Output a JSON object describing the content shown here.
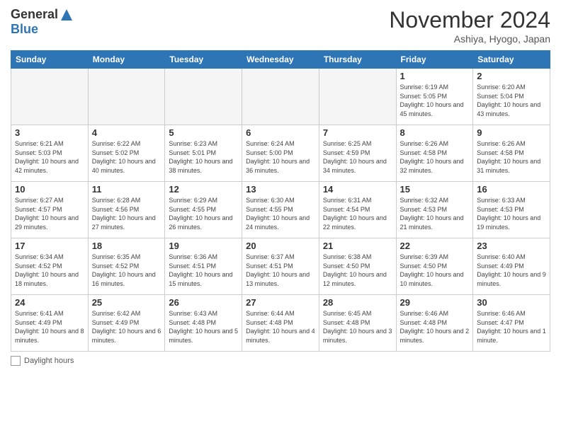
{
  "header": {
    "logo_general": "General",
    "logo_blue": "Blue",
    "month_title": "November 2024",
    "location": "Ashiya, Hyogo, Japan"
  },
  "days_of_week": [
    "Sunday",
    "Monday",
    "Tuesday",
    "Wednesday",
    "Thursday",
    "Friday",
    "Saturday"
  ],
  "legend": {
    "label": "Daylight hours"
  },
  "weeks": [
    [
      {
        "day": "",
        "empty": true
      },
      {
        "day": "",
        "empty": true
      },
      {
        "day": "",
        "empty": true
      },
      {
        "day": "",
        "empty": true
      },
      {
        "day": "",
        "empty": true
      },
      {
        "day": "1",
        "sunrise": "Sunrise: 6:19 AM",
        "sunset": "Sunset: 5:05 PM",
        "daylight": "Daylight: 10 hours and 45 minutes."
      },
      {
        "day": "2",
        "sunrise": "Sunrise: 6:20 AM",
        "sunset": "Sunset: 5:04 PM",
        "daylight": "Daylight: 10 hours and 43 minutes."
      }
    ],
    [
      {
        "day": "3",
        "sunrise": "Sunrise: 6:21 AM",
        "sunset": "Sunset: 5:03 PM",
        "daylight": "Daylight: 10 hours and 42 minutes."
      },
      {
        "day": "4",
        "sunrise": "Sunrise: 6:22 AM",
        "sunset": "Sunset: 5:02 PM",
        "daylight": "Daylight: 10 hours and 40 minutes."
      },
      {
        "day": "5",
        "sunrise": "Sunrise: 6:23 AM",
        "sunset": "Sunset: 5:01 PM",
        "daylight": "Daylight: 10 hours and 38 minutes."
      },
      {
        "day": "6",
        "sunrise": "Sunrise: 6:24 AM",
        "sunset": "Sunset: 5:00 PM",
        "daylight": "Daylight: 10 hours and 36 minutes."
      },
      {
        "day": "7",
        "sunrise": "Sunrise: 6:25 AM",
        "sunset": "Sunset: 4:59 PM",
        "daylight": "Daylight: 10 hours and 34 minutes."
      },
      {
        "day": "8",
        "sunrise": "Sunrise: 6:26 AM",
        "sunset": "Sunset: 4:58 PM",
        "daylight": "Daylight: 10 hours and 32 minutes."
      },
      {
        "day": "9",
        "sunrise": "Sunrise: 6:26 AM",
        "sunset": "Sunset: 4:58 PM",
        "daylight": "Daylight: 10 hours and 31 minutes."
      }
    ],
    [
      {
        "day": "10",
        "sunrise": "Sunrise: 6:27 AM",
        "sunset": "Sunset: 4:57 PM",
        "daylight": "Daylight: 10 hours and 29 minutes."
      },
      {
        "day": "11",
        "sunrise": "Sunrise: 6:28 AM",
        "sunset": "Sunset: 4:56 PM",
        "daylight": "Daylight: 10 hours and 27 minutes."
      },
      {
        "day": "12",
        "sunrise": "Sunrise: 6:29 AM",
        "sunset": "Sunset: 4:55 PM",
        "daylight": "Daylight: 10 hours and 26 minutes."
      },
      {
        "day": "13",
        "sunrise": "Sunrise: 6:30 AM",
        "sunset": "Sunset: 4:55 PM",
        "daylight": "Daylight: 10 hours and 24 minutes."
      },
      {
        "day": "14",
        "sunrise": "Sunrise: 6:31 AM",
        "sunset": "Sunset: 4:54 PM",
        "daylight": "Daylight: 10 hours and 22 minutes."
      },
      {
        "day": "15",
        "sunrise": "Sunrise: 6:32 AM",
        "sunset": "Sunset: 4:53 PM",
        "daylight": "Daylight: 10 hours and 21 minutes."
      },
      {
        "day": "16",
        "sunrise": "Sunrise: 6:33 AM",
        "sunset": "Sunset: 4:53 PM",
        "daylight": "Daylight: 10 hours and 19 minutes."
      }
    ],
    [
      {
        "day": "17",
        "sunrise": "Sunrise: 6:34 AM",
        "sunset": "Sunset: 4:52 PM",
        "daylight": "Daylight: 10 hours and 18 minutes."
      },
      {
        "day": "18",
        "sunrise": "Sunrise: 6:35 AM",
        "sunset": "Sunset: 4:52 PM",
        "daylight": "Daylight: 10 hours and 16 minutes."
      },
      {
        "day": "19",
        "sunrise": "Sunrise: 6:36 AM",
        "sunset": "Sunset: 4:51 PM",
        "daylight": "Daylight: 10 hours and 15 minutes."
      },
      {
        "day": "20",
        "sunrise": "Sunrise: 6:37 AM",
        "sunset": "Sunset: 4:51 PM",
        "daylight": "Daylight: 10 hours and 13 minutes."
      },
      {
        "day": "21",
        "sunrise": "Sunrise: 6:38 AM",
        "sunset": "Sunset: 4:50 PM",
        "daylight": "Daylight: 10 hours and 12 minutes."
      },
      {
        "day": "22",
        "sunrise": "Sunrise: 6:39 AM",
        "sunset": "Sunset: 4:50 PM",
        "daylight": "Daylight: 10 hours and 10 minutes."
      },
      {
        "day": "23",
        "sunrise": "Sunrise: 6:40 AM",
        "sunset": "Sunset: 4:49 PM",
        "daylight": "Daylight: 10 hours and 9 minutes."
      }
    ],
    [
      {
        "day": "24",
        "sunrise": "Sunrise: 6:41 AM",
        "sunset": "Sunset: 4:49 PM",
        "daylight": "Daylight: 10 hours and 8 minutes."
      },
      {
        "day": "25",
        "sunrise": "Sunrise: 6:42 AM",
        "sunset": "Sunset: 4:49 PM",
        "daylight": "Daylight: 10 hours and 6 minutes."
      },
      {
        "day": "26",
        "sunrise": "Sunrise: 6:43 AM",
        "sunset": "Sunset: 4:48 PM",
        "daylight": "Daylight: 10 hours and 5 minutes."
      },
      {
        "day": "27",
        "sunrise": "Sunrise: 6:44 AM",
        "sunset": "Sunset: 4:48 PM",
        "daylight": "Daylight: 10 hours and 4 minutes."
      },
      {
        "day": "28",
        "sunrise": "Sunrise: 6:45 AM",
        "sunset": "Sunset: 4:48 PM",
        "daylight": "Daylight: 10 hours and 3 minutes."
      },
      {
        "day": "29",
        "sunrise": "Sunrise: 6:46 AM",
        "sunset": "Sunset: 4:48 PM",
        "daylight": "Daylight: 10 hours and 2 minutes."
      },
      {
        "day": "30",
        "sunrise": "Sunrise: 6:46 AM",
        "sunset": "Sunset: 4:47 PM",
        "daylight": "Daylight: 10 hours and 1 minute."
      }
    ]
  ]
}
